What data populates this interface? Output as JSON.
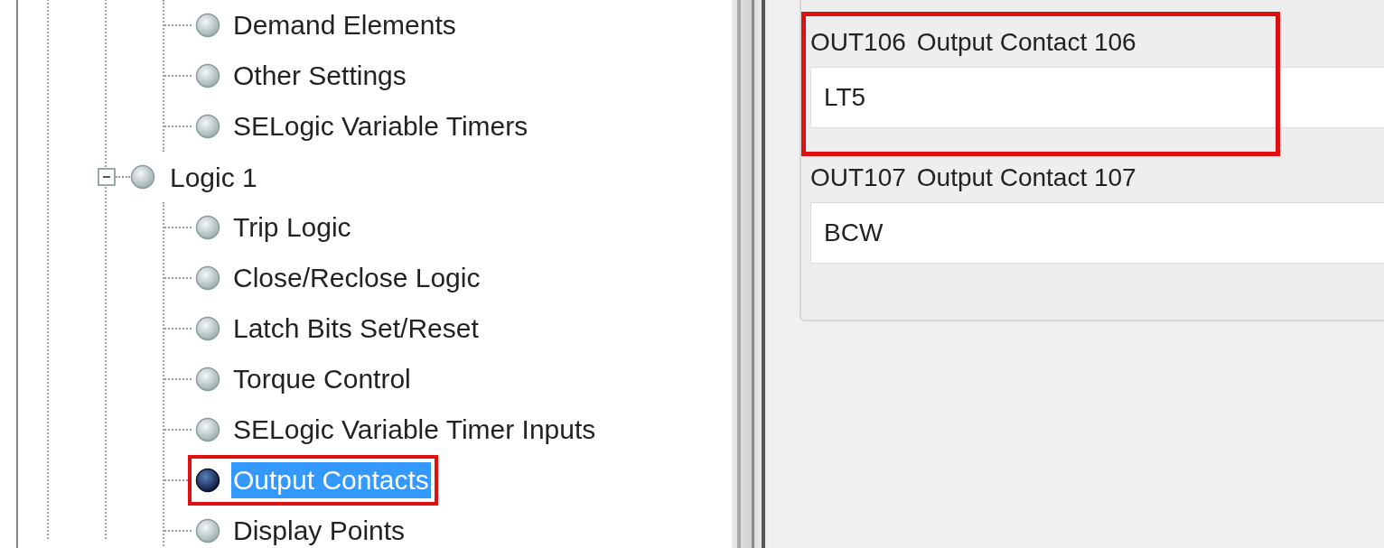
{
  "tree": {
    "previous_group_children": [
      {
        "label": "Demand Elements",
        "selected": false,
        "highlighted": false
      },
      {
        "label": "Other Settings",
        "selected": false,
        "highlighted": false
      },
      {
        "label": "SELogic Variable Timers",
        "selected": false,
        "highlighted": false
      }
    ],
    "groups": [
      {
        "label": "Logic 1",
        "expanded": true,
        "children": [
          {
            "label": "Trip Logic",
            "selected": false,
            "highlighted": false
          },
          {
            "label": "Close/Reclose Logic",
            "selected": false,
            "highlighted": false
          },
          {
            "label": "Latch Bits Set/Reset",
            "selected": false,
            "highlighted": false
          },
          {
            "label": "Torque Control",
            "selected": false,
            "highlighted": false
          },
          {
            "label": "SELogic Variable Timer Inputs",
            "selected": false,
            "highlighted": false
          },
          {
            "label": "Output Contacts",
            "selected": true,
            "highlighted": true
          },
          {
            "label": "Display Points",
            "selected": false,
            "highlighted": false
          }
        ]
      }
    ]
  },
  "settings": [
    {
      "code": "OUT106",
      "label": "Output Contact 106",
      "value": "LT5",
      "highlighted": true
    },
    {
      "code": "OUT107",
      "label": "Output Contact 107",
      "value": "BCW",
      "highlighted": false
    }
  ]
}
